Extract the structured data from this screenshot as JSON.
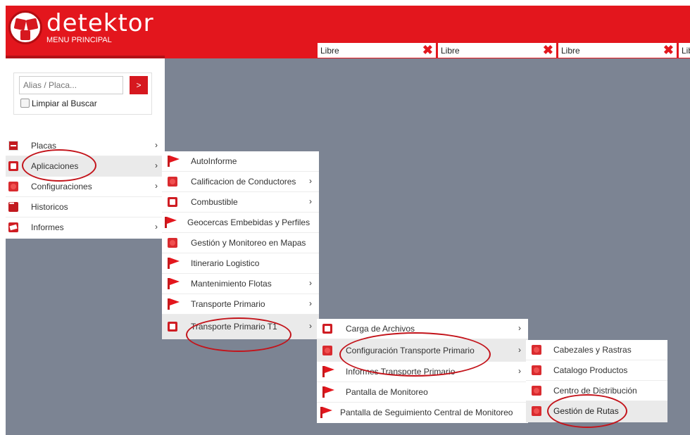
{
  "app": {
    "brand": "detektor",
    "menu_title": "MENU PRINCIPAL"
  },
  "colors": {
    "brand_red": "#e3161d",
    "background": "#7c8493"
  },
  "tabs": [
    {
      "label": "Libre",
      "close": "✖"
    },
    {
      "label": "Libre",
      "close": "✖"
    },
    {
      "label": "Libre",
      "close": "✖"
    },
    {
      "label": "Lib"
    }
  ],
  "search": {
    "placeholder": "Alias / Placa...",
    "button": ">",
    "clear_label": "Limpiar al Buscar"
  },
  "main_menu": [
    {
      "label": "Placas",
      "icon": "plate-icon",
      "arrow": "›"
    },
    {
      "label": "Aplicaciones",
      "icon": "box-icon",
      "arrow": "›"
    },
    {
      "label": "Configuraciones",
      "icon": "config-icon",
      "arrow": "›"
    },
    {
      "label": "Historicos",
      "icon": "history-icon",
      "arrow": ""
    },
    {
      "label": "Informes",
      "icon": "report-icon",
      "arrow": "›"
    }
  ],
  "aplicaciones_menu": [
    {
      "label": "AutoInforme",
      "icon": "flag-icon",
      "arrow": ""
    },
    {
      "label": "Calificacion de Conductores",
      "icon": "config-icon",
      "arrow": "›"
    },
    {
      "label": "Combustible",
      "icon": "box-icon",
      "arrow": "›"
    },
    {
      "label": "Geocercas Embebidas y Perfiles",
      "icon": "flag-icon",
      "arrow": ""
    },
    {
      "label": "Gestión y Monitoreo en Mapas",
      "icon": "config-icon",
      "arrow": ""
    },
    {
      "label": "Itinerario Logistico",
      "icon": "flag-icon",
      "arrow": ""
    },
    {
      "label": "Mantenimiento Flotas",
      "icon": "flag-icon",
      "arrow": "›"
    },
    {
      "label": "Transporte Primario",
      "icon": "flag-icon",
      "arrow": "›"
    },
    {
      "label": "Transporte Primario T1",
      "icon": "box-icon",
      "arrow": "›"
    }
  ],
  "transporte_t1_menu": [
    {
      "label": "Carga de Archivos",
      "icon": "box-icon",
      "arrow": "›"
    },
    {
      "label": "Configuración Transporte Primario",
      "icon": "config-icon",
      "arrow": "›"
    },
    {
      "label": "Informes Transporte Primario",
      "icon": "flag-icon",
      "arrow": "›"
    },
    {
      "label": "Pantalla de Monitoreo",
      "icon": "flag-icon",
      "arrow": ""
    },
    {
      "label": "Pantalla de Seguimiento Central de Monitoreo",
      "icon": "flag-icon",
      "arrow": ""
    }
  ],
  "configuracion_menu": [
    {
      "label": "Cabezales y Rastras",
      "icon": "config-icon"
    },
    {
      "label": "Catalogo Productos",
      "icon": "config-icon"
    },
    {
      "label": "Centro de Distribución",
      "icon": "config-icon"
    },
    {
      "label": "Gestión de Rutas",
      "icon": "config-icon"
    }
  ]
}
